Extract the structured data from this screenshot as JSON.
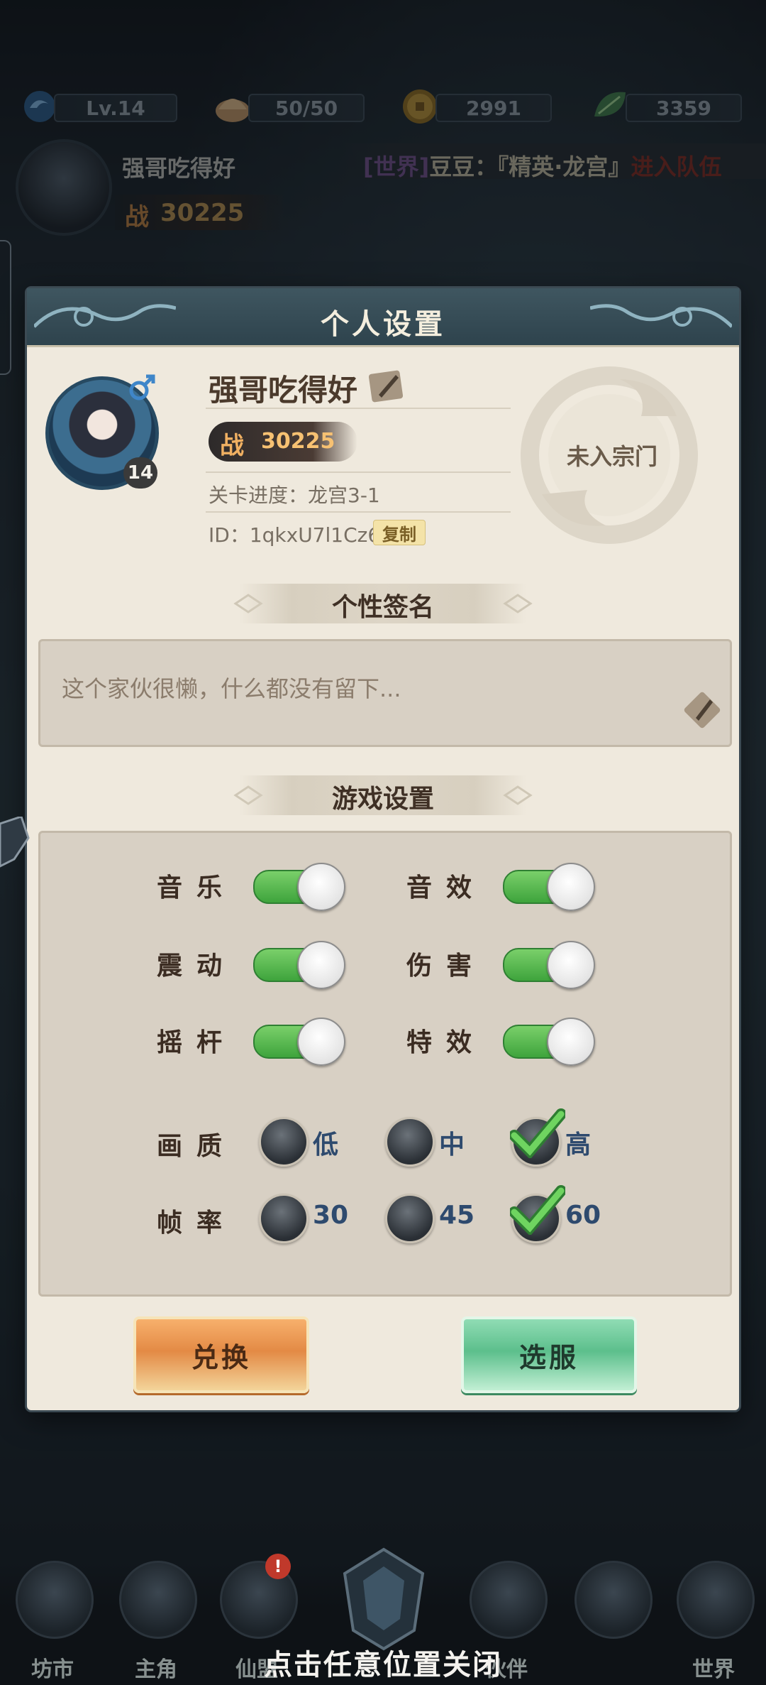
{
  "top_bar": {
    "level": "Lv.14",
    "stamina": "50/50",
    "coins": "2991",
    "jade": "3359"
  },
  "player_header": {
    "name": "强哥吃得好",
    "power_label": "战",
    "power": "30225"
  },
  "world_chat": {
    "tag": "[世界]",
    "message": "豆豆：『精英·龙宫』",
    "action": "进入队伍"
  },
  "modal": {
    "title": "个人设置",
    "profile": {
      "name": "强哥吃得好",
      "level": "14",
      "power_label": "战",
      "power": "30225",
      "stage_progress": "关卡进度：龙宫3-1",
      "id_label": "ID：1qkxU7l1Cz6",
      "copy_label": "复制",
      "sect": "未入宗门"
    },
    "signature": {
      "section_title": "个性签名",
      "text": "这个家伙很懒，什么都没有留下..."
    },
    "game_settings": {
      "section_title": "游戏设置",
      "toggles": [
        {
          "label": "音乐",
          "on": true
        },
        {
          "label": "音效",
          "on": true
        },
        {
          "label": "震动",
          "on": true
        },
        {
          "label": "伤害",
          "on": true
        },
        {
          "label": "摇杆",
          "on": true
        },
        {
          "label": "特效",
          "on": true
        }
      ],
      "quality": {
        "label": "画质",
        "options": [
          "低",
          "中",
          "高"
        ],
        "selected": "高"
      },
      "framerate": {
        "label": "帧率",
        "options": [
          "30",
          "45",
          "60"
        ],
        "selected": "60"
      }
    },
    "buttons": {
      "redeem": "兑换",
      "select_server": "选服"
    }
  },
  "bottom_nav": {
    "items": [
      "坊市",
      "主角",
      "仙盟",
      "伙伴",
      "世界"
    ],
    "badge": "!"
  },
  "close_hint": "点击任意位置关闭",
  "colors": {
    "toggle_on": "#4cb347",
    "modal_bg": "#efe9dd",
    "header_bg": "#34505b",
    "redeem_button": "#e99650",
    "server_button": "#6cc89a",
    "option_label": "#2e4a6e"
  }
}
